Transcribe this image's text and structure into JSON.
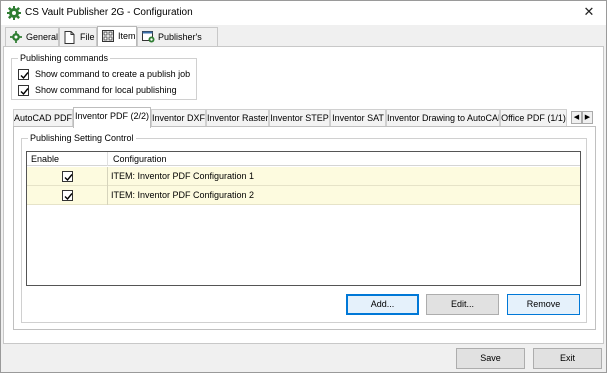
{
  "window": {
    "title": "CS Vault Publisher 2G - Configuration",
    "close_glyph": "✕"
  },
  "top_tabs": [
    {
      "label": "General",
      "icon": "gear-icon"
    },
    {
      "label": "File",
      "icon": "file-icon"
    },
    {
      "label": "Item",
      "icon": "item-grid-icon",
      "active": true
    },
    {
      "label": "Publisher's Jobs",
      "icon": "jobs-icon"
    }
  ],
  "publishing_commands": {
    "legend": "Publishing commands",
    "options": [
      {
        "label": "Show command to create a publish job",
        "checked": true
      },
      {
        "label": "Show command for local publishing",
        "checked": true
      }
    ]
  },
  "format_tabs": [
    {
      "label": "AutoCAD PDF"
    },
    {
      "label": "Inventor PDF (2/2)",
      "active": true
    },
    {
      "label": "Inventor DXF"
    },
    {
      "label": "Inventor Raster"
    },
    {
      "label": "Inventor STEP"
    },
    {
      "label": "Inventor SAT"
    },
    {
      "label": "Inventor Drawing to AutoCAD"
    },
    {
      "label": "Office PDF (1/1)"
    }
  ],
  "scroll_arrows": {
    "left": "◀",
    "right": "▶"
  },
  "setting_control": {
    "legend": "Publishing Setting Control",
    "columns": [
      "Enable",
      "Configuration"
    ],
    "rows": [
      {
        "enabled": true,
        "configuration": "ITEM: Inventor PDF Configuration 1"
      },
      {
        "enabled": true,
        "configuration": "ITEM: Inventor PDF Configuration 2"
      }
    ],
    "buttons": {
      "add": "Add...",
      "edit": "Edit...",
      "remove": "Remove"
    }
  },
  "footer": {
    "save": "Save",
    "exit": "Exit"
  },
  "colors": {
    "row_highlight": "#fdfbdf",
    "accent": "#0078d7",
    "icon_green": "#2e7d32"
  }
}
